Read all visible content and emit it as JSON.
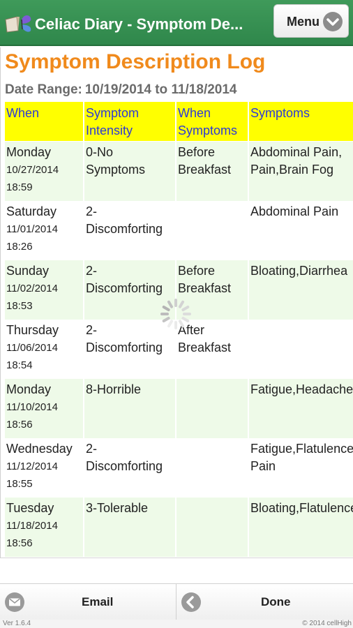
{
  "header": {
    "title": "Celiac Diary - Symptom De...",
    "menu_label": "Menu",
    "icon": "butterfly-book-icon"
  },
  "page": {
    "title": "Symptom Description Log",
    "date_range_label": "Date Range:",
    "date_range_value": "10/19/2014 to 11/18/2014"
  },
  "table": {
    "headers": {
      "when": "When",
      "intensity_1": "Symptom",
      "intensity_2": "Intensity",
      "when_sym_1": "When",
      "when_sym_2": "Symptoms",
      "symptoms": "Symptoms"
    },
    "rows": [
      {
        "day": "Monday",
        "date": "10/27/2014",
        "time": "18:59",
        "intensity": "0-No Symptoms",
        "when": "Before Breakfast",
        "symptoms": "Abdominal Pain, Pain,Brain Fog"
      },
      {
        "day": "Saturday",
        "date": "11/01/2014",
        "time": "18:26",
        "intensity": "2-Discomforting",
        "when": "",
        "symptoms": "Abdominal Pain"
      },
      {
        "day": "Sunday",
        "date": "11/02/2014",
        "time": "18:53",
        "intensity": "2-Discomforting",
        "when": "Before Breakfast",
        "symptoms": "Bloating,Diarrhea"
      },
      {
        "day": "Thursday",
        "date": "11/06/2014",
        "time": "18:54",
        "intensity": "2-Discomforting",
        "when": "After Breakfast",
        "symptoms": ""
      },
      {
        "day": "Monday",
        "date": "11/10/2014",
        "time": "18:56",
        "intensity": "8-Horrible",
        "when": "",
        "symptoms": "Fatigue,Headache"
      },
      {
        "day": "Wednesday",
        "date": "11/12/2014",
        "time": "18:55",
        "intensity": "2-Discomforting",
        "when": "",
        "symptoms": "Fatigue,Flatulence Pain"
      },
      {
        "day": "Tuesday",
        "date": "11/18/2014",
        "time": "18:56",
        "intensity": "3-Tolerable",
        "when": "",
        "symptoms": "Bloating,Flatulence"
      }
    ]
  },
  "footer": {
    "email_label": "Email",
    "email_icon": "envelope-icon",
    "done_label": "Done",
    "done_icon": "back-arrow-icon",
    "version": "Ver 1.6.4",
    "copyright": "© 2014 cellHigh"
  },
  "colors": {
    "header_green": "#2f874b",
    "title_orange": "#f08a1c",
    "header_row_yellow": "#ffff00",
    "header_text_blue": "#2d3ad6",
    "row_alt_green": "#eefae8"
  }
}
